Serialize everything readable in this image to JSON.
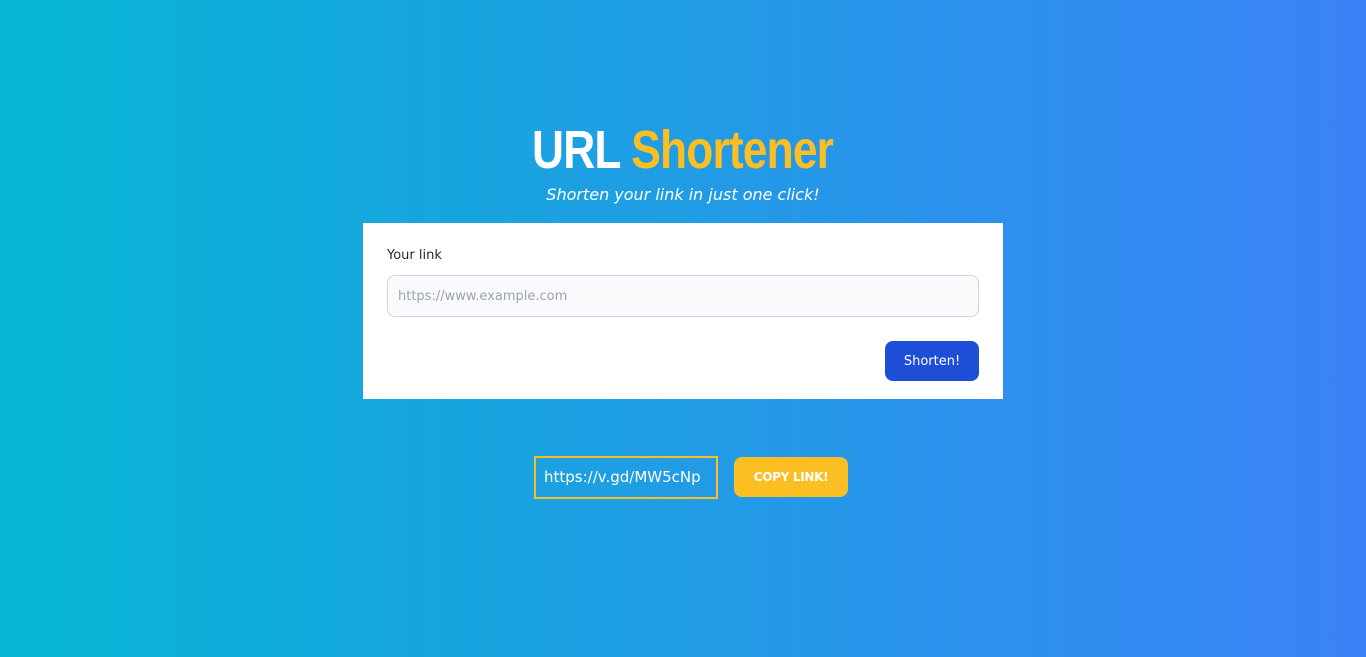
{
  "header": {
    "title_part1": "URL",
    "title_part2": "Shortener",
    "subtitle": "Shorten your link in just one click!"
  },
  "form": {
    "label": "Your link",
    "input_value": "",
    "input_placeholder": "https://www.example.com",
    "submit_label": "Shorten!"
  },
  "result": {
    "short_url": "https://v.gd/MW5cNp",
    "copy_label": "COPY LINK!"
  },
  "colors": {
    "gradient_start": "#06b6d4",
    "gradient_end": "#3b82f6",
    "accent_yellow": "#fbbf24",
    "button_blue": "#1d4ed8"
  }
}
